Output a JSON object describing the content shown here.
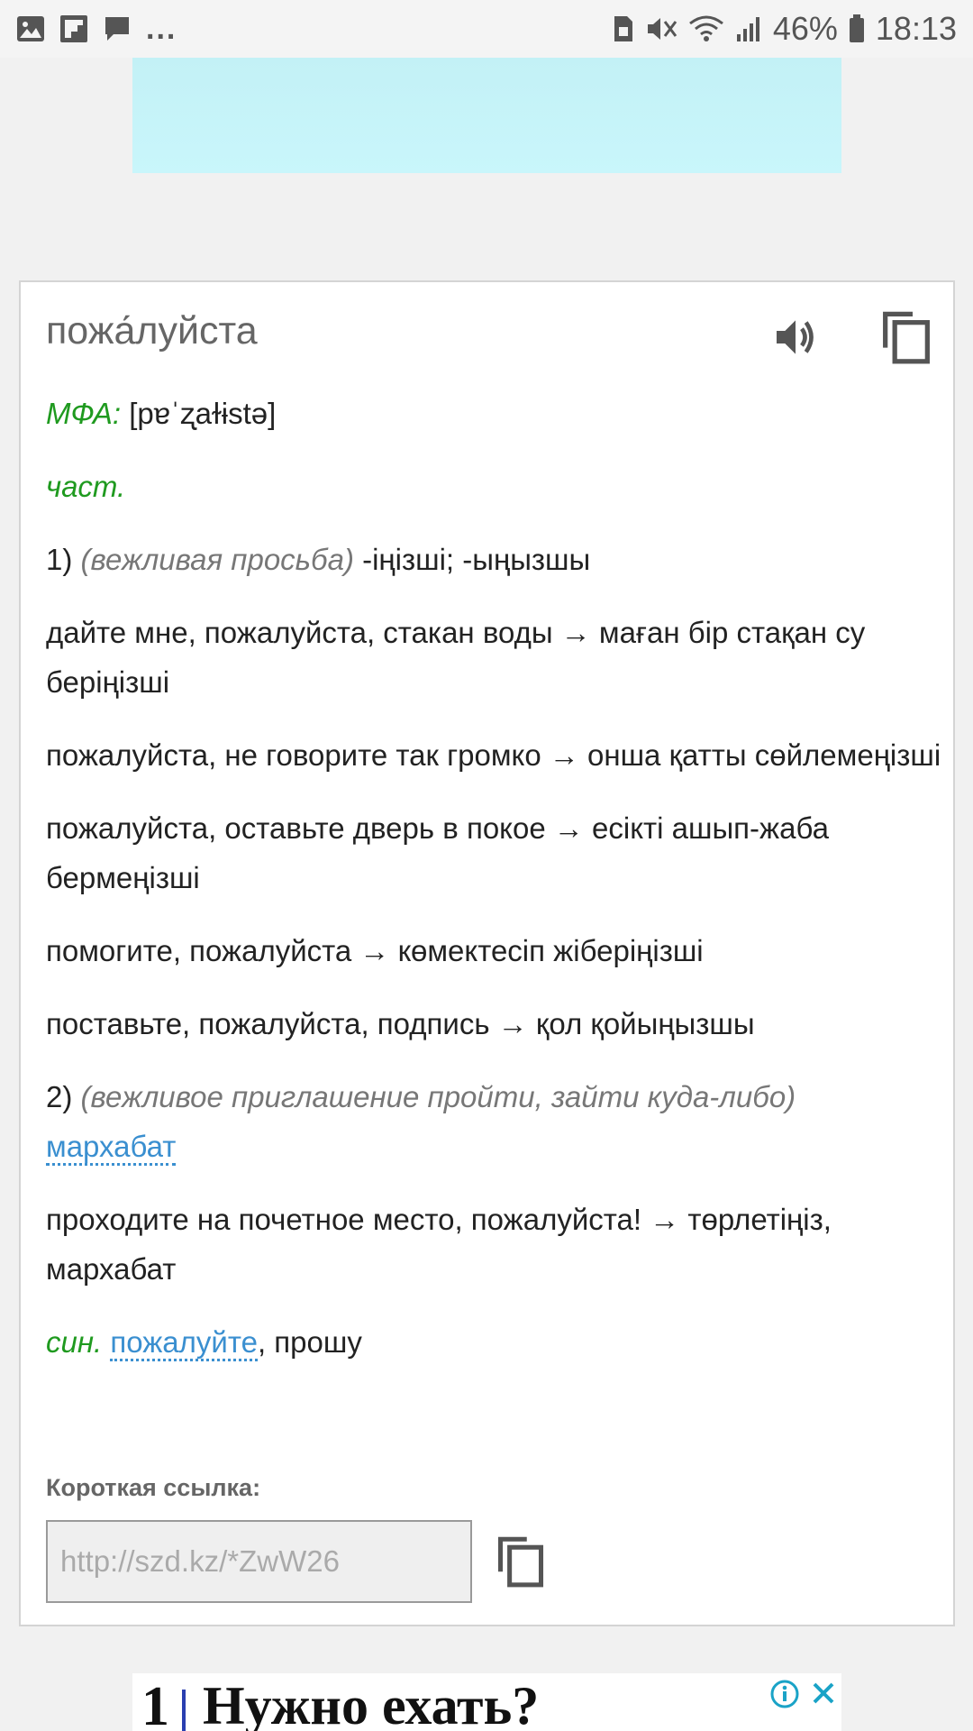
{
  "status_bar": {
    "left_icons": [
      "image-icon",
      "flipboard-icon",
      "message-icon"
    ],
    "ellipsis": "...",
    "right_icons": [
      "sim-icon",
      "mute-icon",
      "wifi-icon",
      "signal-icon",
      "battery-icon"
    ],
    "battery": "46%",
    "time": "18:13"
  },
  "entry": {
    "headword": "пожа́луйста",
    "speaker_icon": "speaker-icon",
    "copy_icon": "copy-icon",
    "ipa_label": "МФА:",
    "ipa": "[pɐˈʐaɫɨstə]",
    "pos": "част.",
    "sense1_num": "1)",
    "sense1_note": "(вежливая просьба)",
    "sense1_translation": "-іңізші; -ыңызшы",
    "examples1": [
      "дайте мне, пожалуйста, стакан воды → маған бір стақан су беріңізші",
      "пожалуйста, не говорите так громко → онша қатты сөйлемеңізші",
      "пожалуйста, оставьте дверь в покое → есікті ашып-жаба бермеңізші",
      "помогите, пожалуйста → көмектесіп жіберіңізші",
      "поставьте, пожалуйста, подпись → қол қойыңызшы"
    ],
    "sense2_num": "2)",
    "sense2_note": "(вежливое приглашение пройти, зайти куда-либо)",
    "sense2_link": "мархабат",
    "example2": "проходите на почетное место, пожалуйста! → төрлетіңіз, мархабат",
    "syn_label": "син.",
    "syn_link": "пожалуйте",
    "syn_rest": ", прошу"
  },
  "short_link": {
    "label": "Короткая ссылка:",
    "placeholder": "http://szd.kz/*ZwW26",
    "copy_icon": "copy-icon"
  },
  "bottom_ad": {
    "number": "1",
    "title": "Нужно ехать?",
    "info_icon": "info-icon",
    "close_icon": "close-icon"
  },
  "colors": {
    "accent_green": "#1f9a1f",
    "link_blue": "#3a8fd0",
    "ad_bg": "#c6f4f9"
  }
}
